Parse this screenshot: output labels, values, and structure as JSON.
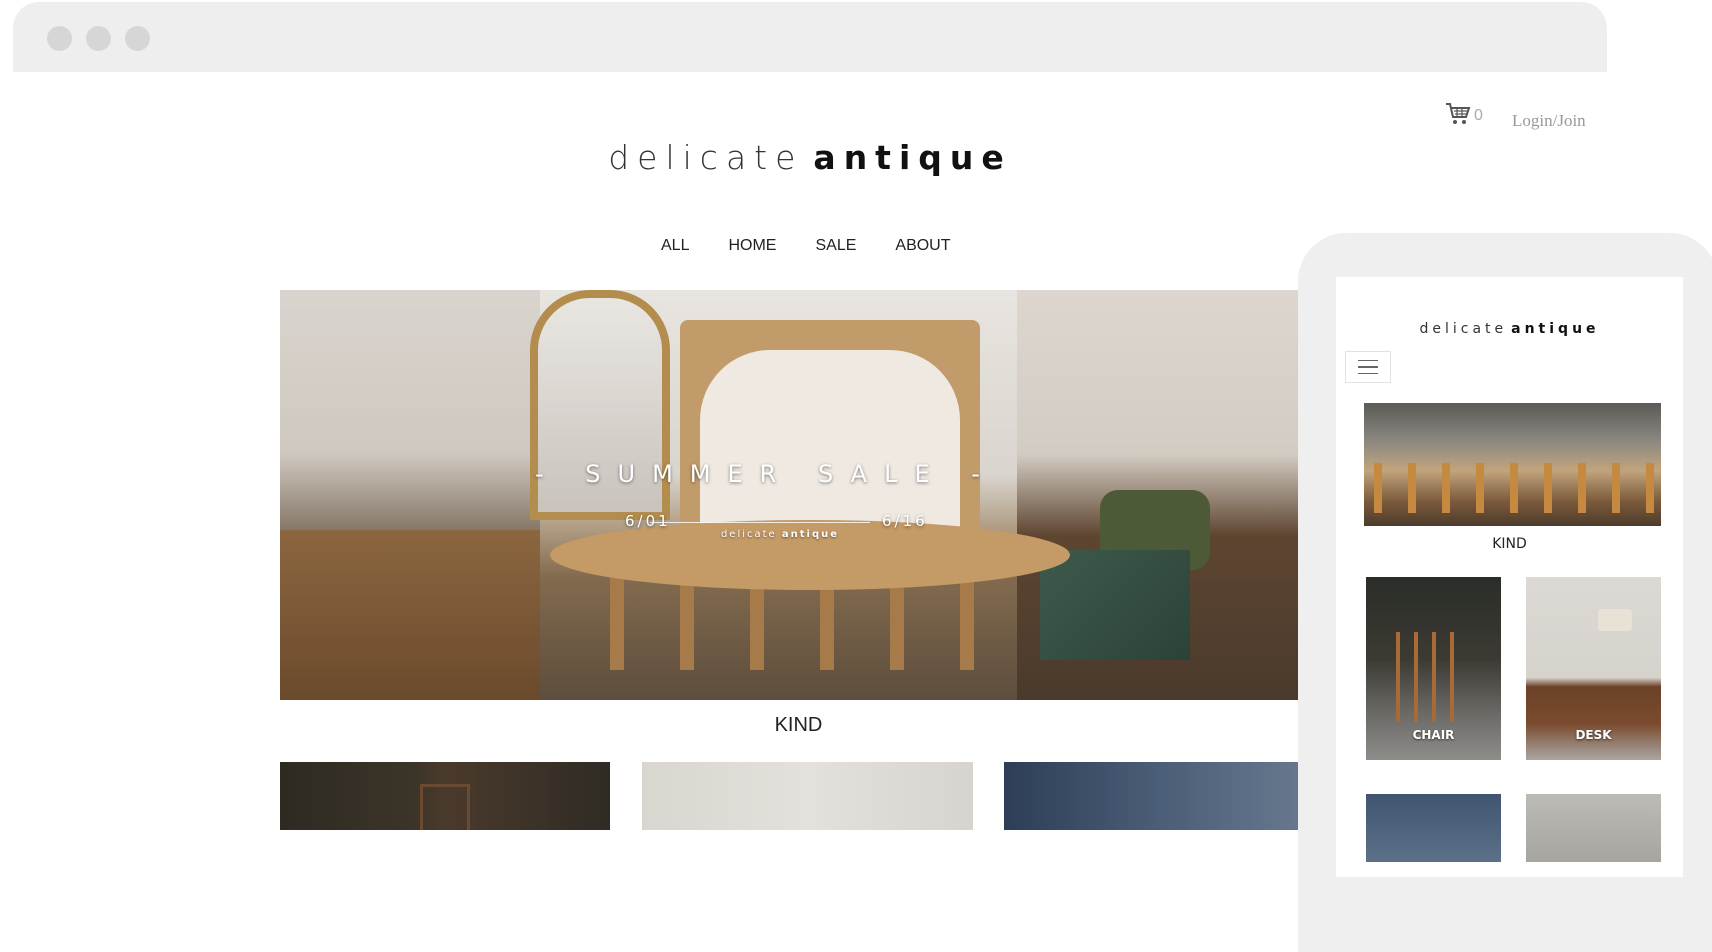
{
  "colors": {
    "browser_chrome": "#eeeeee",
    "window_dot": "#d6d6d6",
    "header_link": "#999999",
    "text": "#222222"
  },
  "header": {
    "cart_icon": "shopping-cart-icon",
    "cart_count": "0",
    "login_label": "Login/Join"
  },
  "brand": {
    "light": "delicate",
    "bold": "antique"
  },
  "nav": {
    "items": [
      "ALL",
      "HOME",
      "SALE",
      "ABOUT"
    ]
  },
  "hero": {
    "title": "- SUMMER SALE -",
    "date_start": "6/01",
    "date_end": "6/16",
    "brand_light": "delicate",
    "brand_bold": "antique"
  },
  "kind_section": {
    "heading": "KIND"
  },
  "mobile": {
    "menu_icon": "hamburger-menu-icon",
    "kind_heading": "KIND",
    "cards": [
      "CHAIR",
      "DESK"
    ]
  }
}
